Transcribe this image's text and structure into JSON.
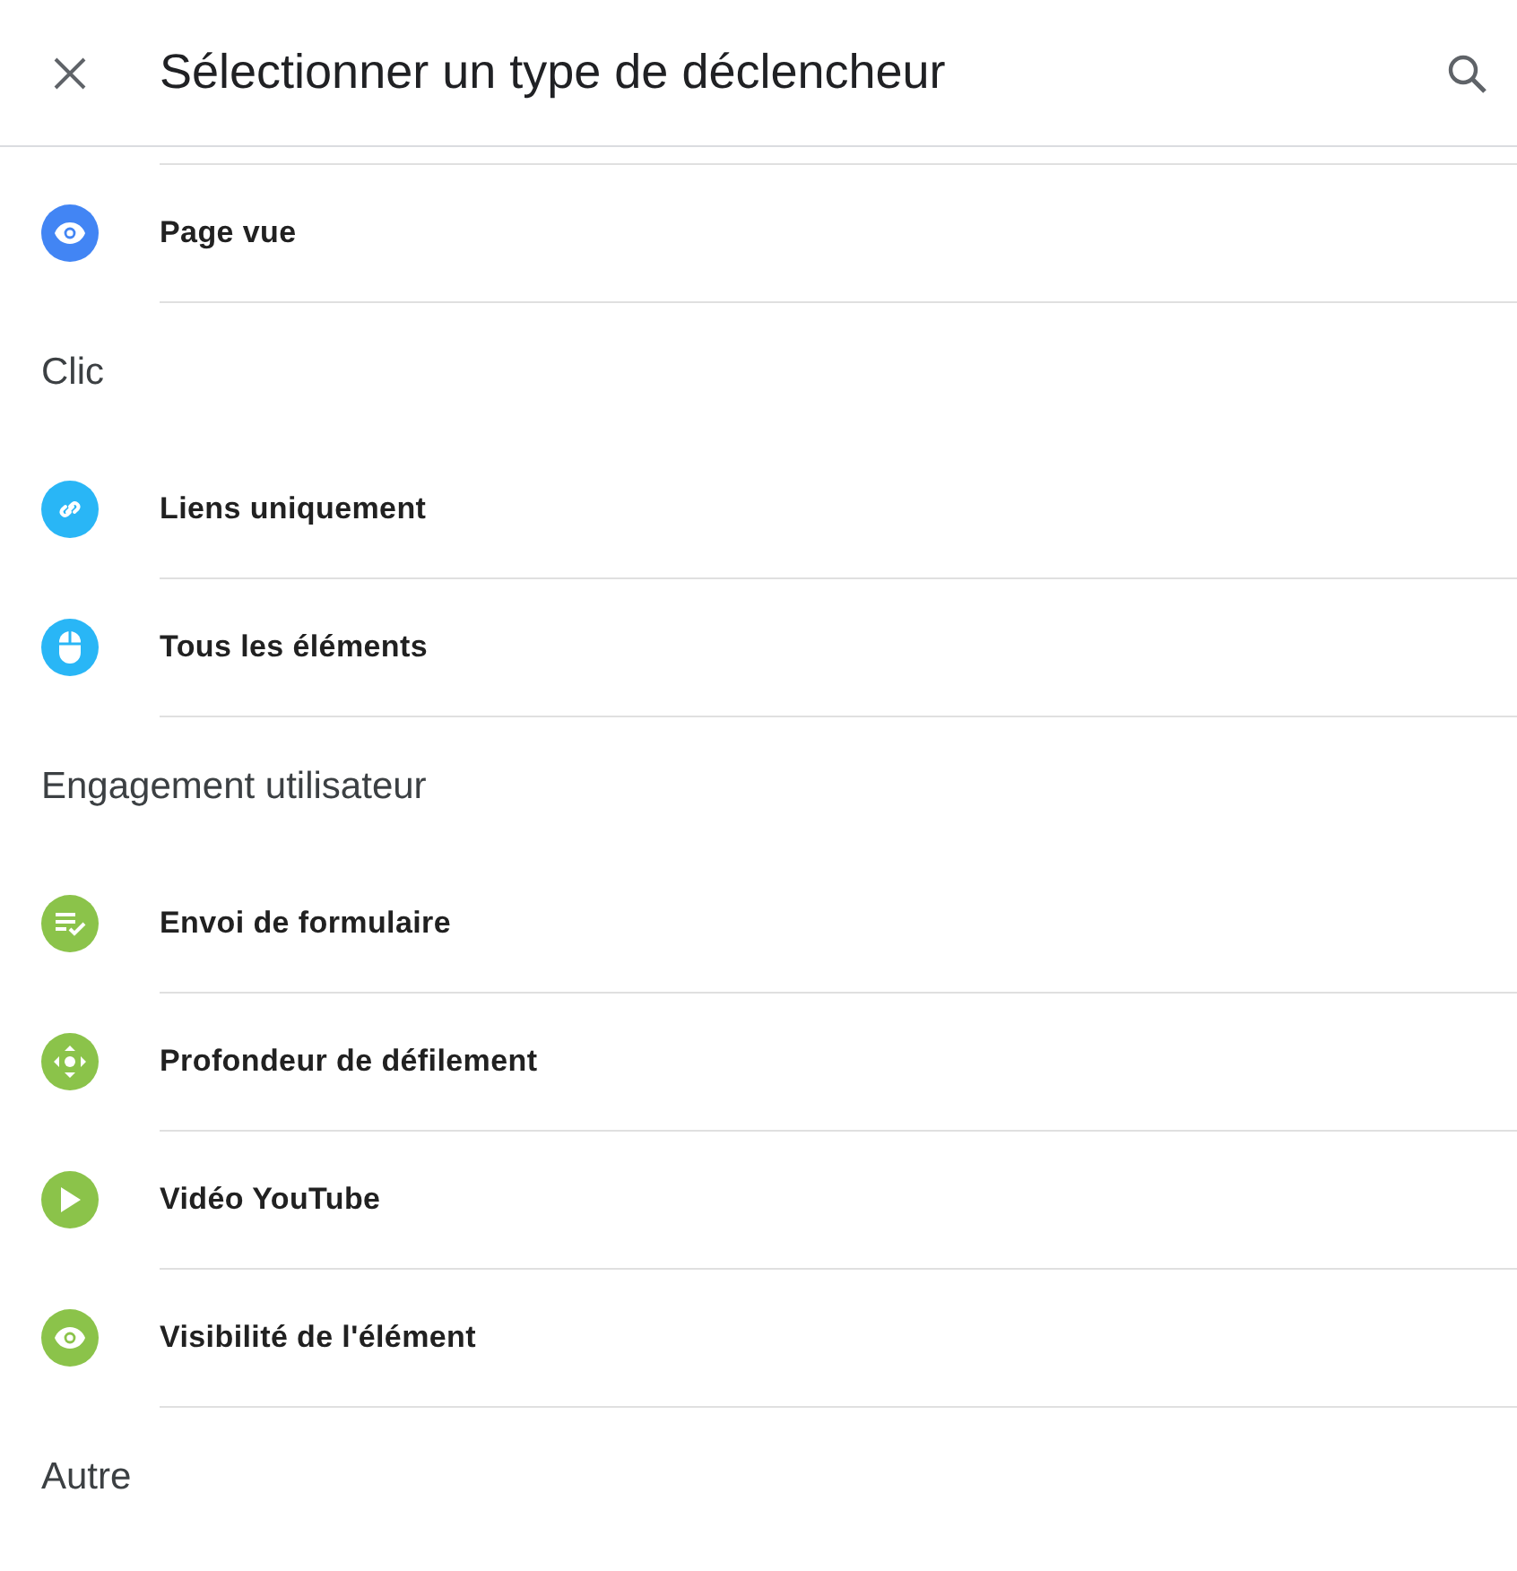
{
  "header": {
    "title": "Sélectionner un type de déclencheur"
  },
  "sections": [
    {
      "items": [
        {
          "kind": "pageview",
          "label": "Page vue",
          "color": "#4285f4"
        }
      ]
    },
    {
      "title": "Clic",
      "items": [
        {
          "kind": "link",
          "label": "Liens uniquement",
          "color": "#29b6f6"
        },
        {
          "kind": "click",
          "label": "Tous les éléments",
          "color": "#29b6f6"
        }
      ]
    },
    {
      "title": "Engagement utilisateur",
      "items": [
        {
          "kind": "form",
          "label": "Envoi de formulaire",
          "color": "#8bc34a"
        },
        {
          "kind": "scroll",
          "label": "Profondeur de défilement",
          "color": "#8bc34a"
        },
        {
          "kind": "video",
          "label": "Vidéo YouTube",
          "color": "#8bc34a"
        },
        {
          "kind": "visibility",
          "label": "Visibilité de l'élément",
          "color": "#8bc34a"
        }
      ]
    },
    {
      "title": "Autre"
    }
  ]
}
